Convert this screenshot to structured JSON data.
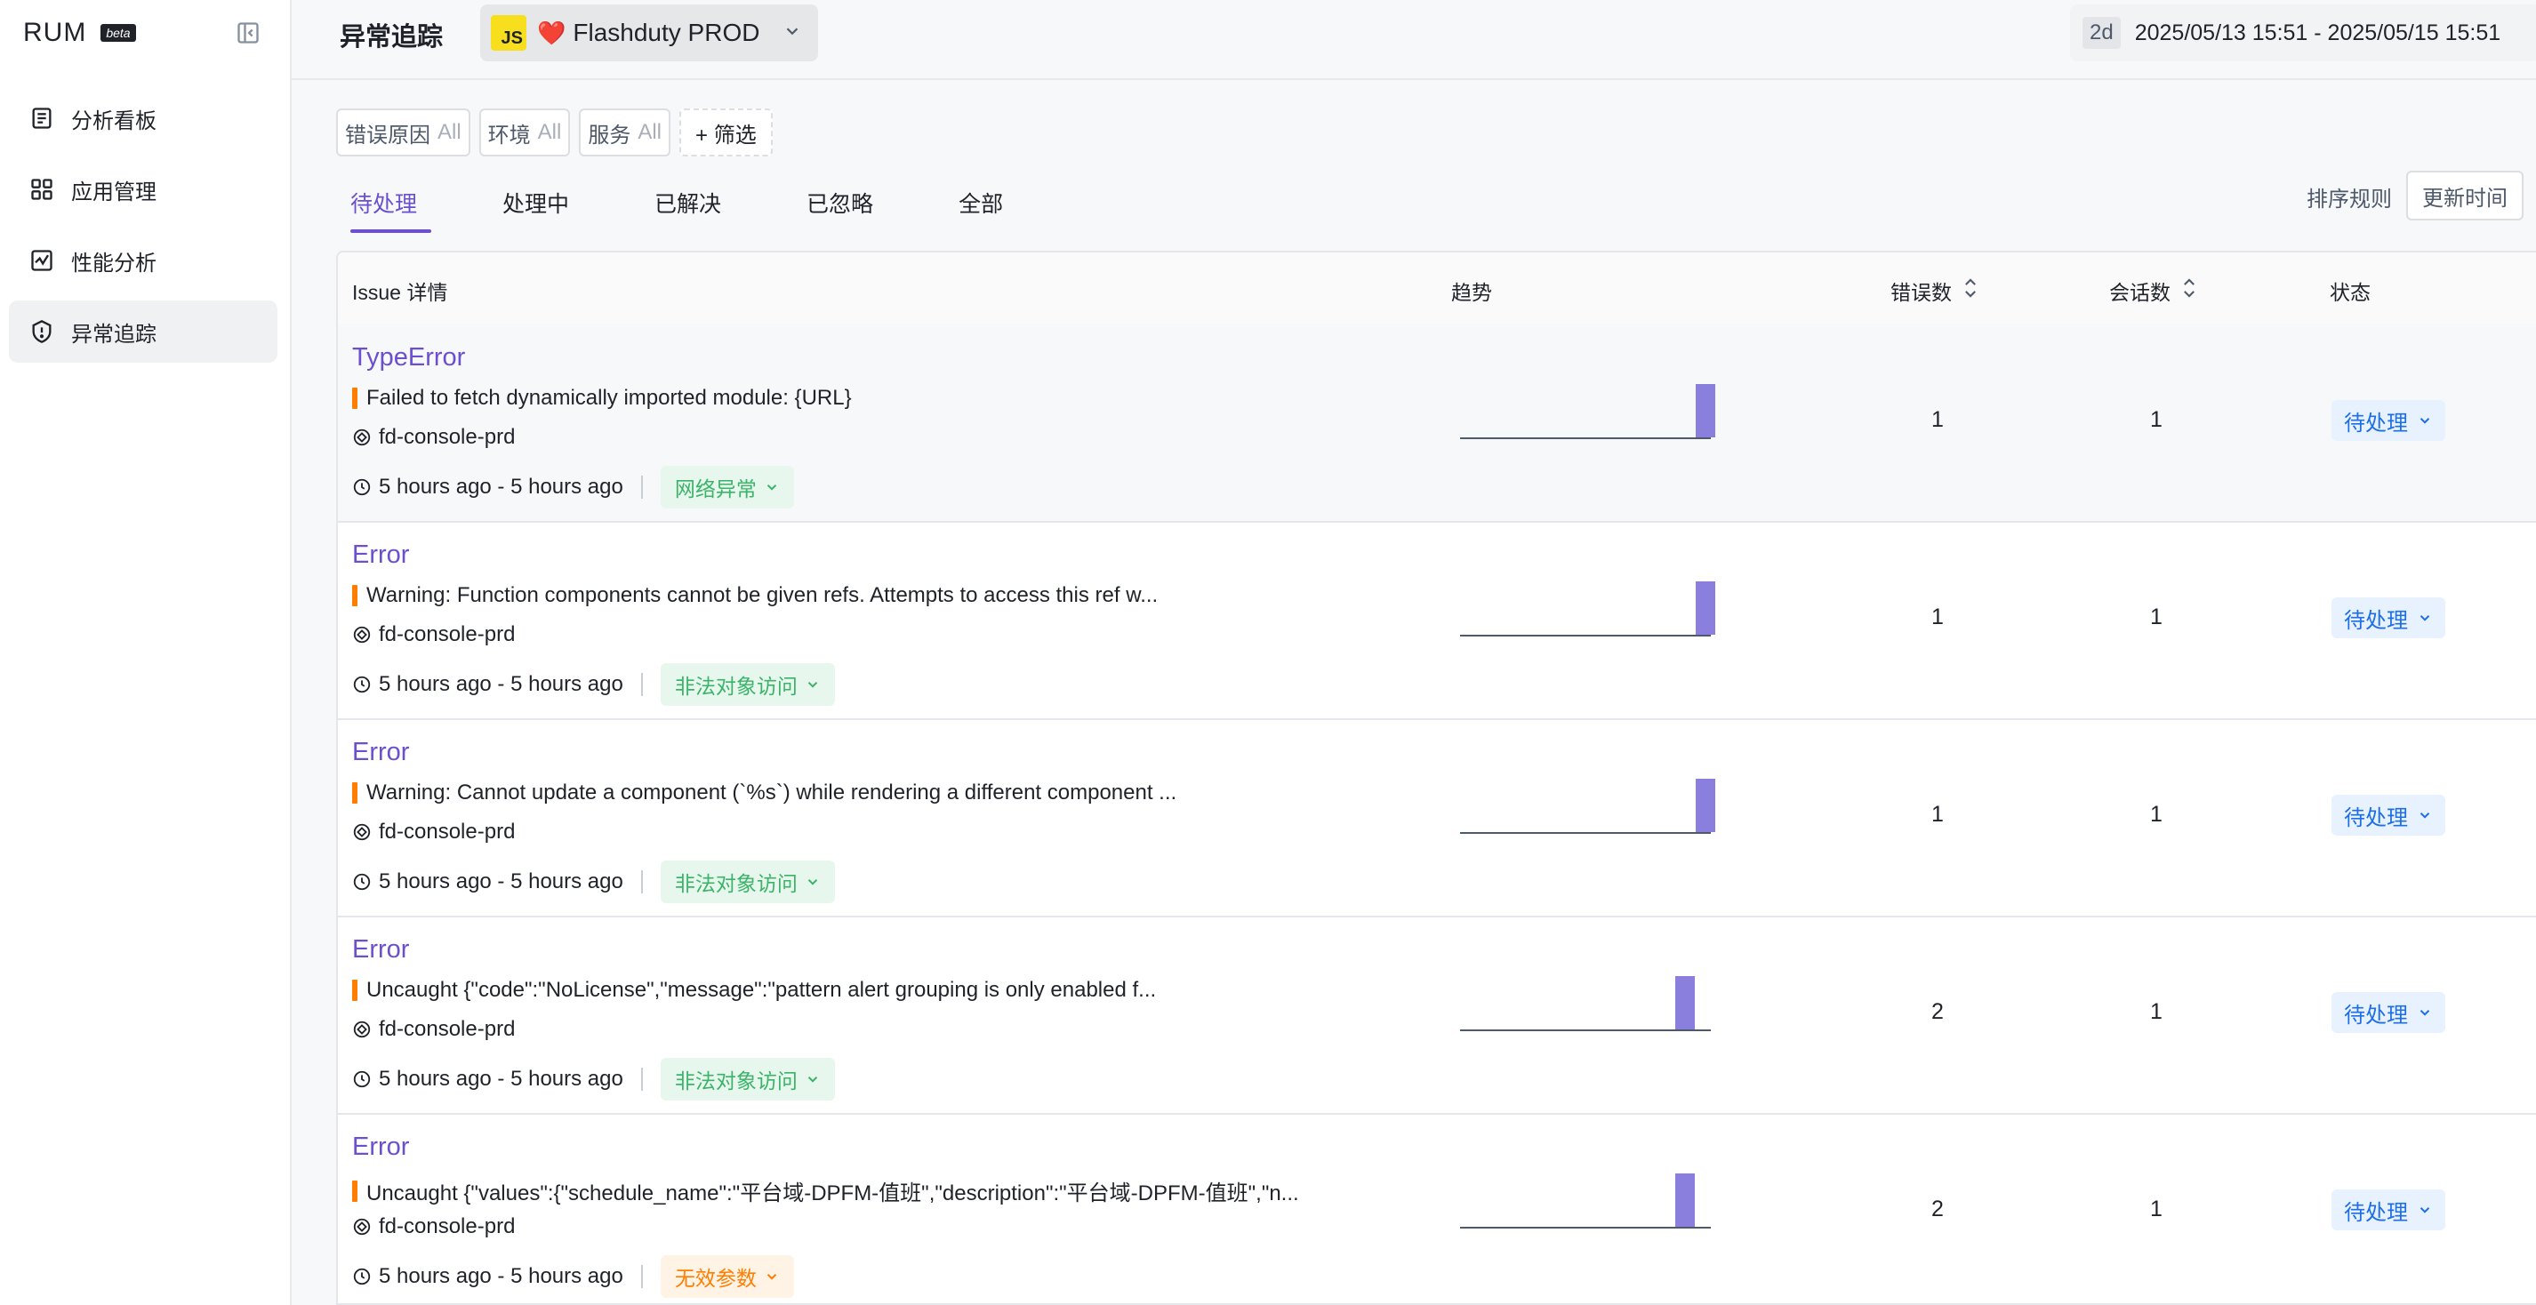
{
  "sidebar": {
    "brand": "RUM",
    "badge": "beta",
    "items": [
      {
        "label": "分析看板",
        "icon": "dashboard-icon"
      },
      {
        "label": "应用管理",
        "icon": "apps-grid-icon"
      },
      {
        "label": "性能分析",
        "icon": "performance-chart-icon"
      },
      {
        "label": "异常追踪",
        "icon": "shield-alert-icon"
      }
    ]
  },
  "header": {
    "title": "异常追踪",
    "app_badge": "JS",
    "app_heart": "❤️",
    "app_name": "Flashduty PROD",
    "time_short": "2d",
    "time_range": "2025/05/13 15:51 - 2025/05/15 15:51"
  },
  "filters": [
    {
      "label": "错误原因",
      "value": "All"
    },
    {
      "label": "环境",
      "value": "All"
    },
    {
      "label": "服务",
      "value": "All"
    }
  ],
  "filter_add": "+ 筛选",
  "tabs": [
    "待处理",
    "处理中",
    "已解决",
    "已忽略",
    "全部"
  ],
  "active_tab": "待处理",
  "sort": {
    "label": "排序规则",
    "value": "更新时间"
  },
  "table": {
    "columns": [
      "Issue 详情",
      "趋势",
      "错误数",
      "会话数",
      "状态"
    ],
    "rows": [
      {
        "title": "TypeError",
        "message": "Failed to fetch dynamically imported module: {URL}",
        "service": "fd-console-prd",
        "time": "5 hours ago - 5 hours ago",
        "tag": "网络异常",
        "tag_color": "#3bb368",
        "trend": [
          0,
          0,
          0,
          0,
          0,
          0,
          0,
          0,
          0,
          0,
          0,
          1
        ],
        "errors": "1",
        "sessions": "1",
        "status": "待处理"
      },
      {
        "title": "Error",
        "message": "Warning: Function components cannot be given refs. Attempts to access this ref w...",
        "service": "fd-console-prd",
        "time": "5 hours ago - 5 hours ago",
        "tag": "非法对象访问",
        "tag_color": "#3bb368",
        "trend": [
          0,
          0,
          0,
          0,
          0,
          0,
          0,
          0,
          0,
          0,
          0,
          1
        ],
        "errors": "1",
        "sessions": "1",
        "status": "待处理"
      },
      {
        "title": "Error",
        "message": "Warning: Cannot update a component (`%s`) while rendering a different component ...",
        "service": "fd-console-prd",
        "time": "5 hours ago - 5 hours ago",
        "tag": "非法对象访问",
        "tag_color": "#3bb368",
        "trend": [
          0,
          0,
          0,
          0,
          0,
          0,
          0,
          0,
          0,
          0,
          0,
          1
        ],
        "errors": "1",
        "sessions": "1",
        "status": "待处理"
      },
      {
        "title": "Error",
        "message": "Uncaught {\"code\":\"NoLicense\",\"message\":\"pattern alert grouping is only enabled f...",
        "service": "fd-console-prd",
        "time": "5 hours ago - 5 hours ago",
        "tag": "非法对象访问",
        "tag_color": "#3bb368",
        "trend": [
          0,
          0,
          0,
          0,
          0,
          0,
          0,
          0,
          0,
          0,
          1,
          0
        ],
        "errors": "2",
        "sessions": "1",
        "status": "待处理"
      },
      {
        "title": "Error",
        "message": "Uncaught {\"values\":{\"schedule_name\":\"平台域-DPFM-值班\",\"description\":\"平台域-DPFM-值班\",\"n...",
        "service": "fd-console-prd",
        "time": "5 hours ago - 5 hours ago",
        "tag": "无效参数",
        "tag_color": "#ff7d00",
        "trend": [
          0,
          0,
          0,
          0,
          0,
          0,
          0,
          0,
          0,
          0,
          1,
          0
        ],
        "errors": "2",
        "sessions": "1",
        "status": "待处理"
      }
    ]
  },
  "colors": {
    "accent": "#6b4fcf",
    "bar": "#8a7fdc",
    "status_blue": "#1e6ee6",
    "orange": "#ff7d00",
    "green": "#3bb368"
  }
}
